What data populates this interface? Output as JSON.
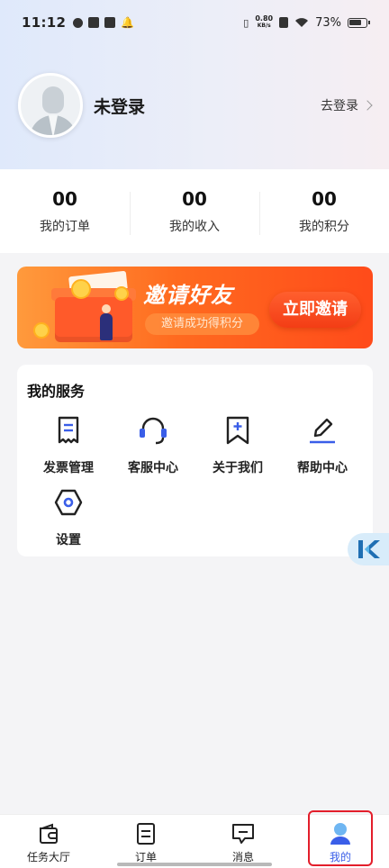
{
  "status_bar": {
    "time": "11:12",
    "net_speed_value": "0.80",
    "net_speed_unit": "KB/s",
    "battery": "73%"
  },
  "profile": {
    "name": "未登录",
    "login_link": "去登录"
  },
  "stats": [
    {
      "value": "00",
      "label": "我的订单"
    },
    {
      "value": "00",
      "label": "我的收入"
    },
    {
      "value": "00",
      "label": "我的积分"
    }
  ],
  "banner": {
    "title": "邀请好友",
    "subtitle": "邀请成功得积分",
    "button": "立即邀请"
  },
  "services": {
    "title": "我的服务",
    "items": [
      {
        "label": "发票管理",
        "icon": "invoice-icon"
      },
      {
        "label": "客服中心",
        "icon": "headset-icon"
      },
      {
        "label": "关于我们",
        "icon": "bookmark-plus-icon"
      },
      {
        "label": "帮助中心",
        "icon": "pencil-icon"
      },
      {
        "label": "设置",
        "icon": "hexagon-settings-icon"
      }
    ]
  },
  "bottom_nav": {
    "items": [
      {
        "label": "任务大厅",
        "icon": "wallet-icon"
      },
      {
        "label": "订单",
        "icon": "document-icon"
      },
      {
        "label": "消息",
        "icon": "message-icon"
      },
      {
        "label": "我的",
        "icon": "person-icon",
        "active": true
      }
    ]
  },
  "colors": {
    "accent": "#3a5ee8",
    "banner_orange": "#ff5a22",
    "highlight_red": "#e31e2b"
  }
}
